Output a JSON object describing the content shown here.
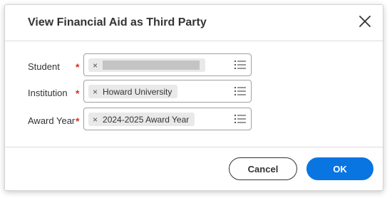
{
  "dialog": {
    "title": "View Financial Aid as Third Party",
    "close_icon": "close-icon"
  },
  "fields": [
    {
      "label": "Student",
      "required_marker": "*",
      "value": ""
    },
    {
      "label": "Institution",
      "required_marker": "*",
      "value": "Howard University"
    },
    {
      "label": "Award Year",
      "required_marker": "*",
      "value": "2024-2025 Award Year"
    }
  ],
  "pill_remove_glyph": "×",
  "prompt_icon": "list-prompt-icon",
  "footer": {
    "cancel_label": "Cancel",
    "ok_label": "OK"
  },
  "colors": {
    "primary": "#0875e1",
    "required": "#de2e21",
    "pill_bg": "#e9e9e9"
  }
}
